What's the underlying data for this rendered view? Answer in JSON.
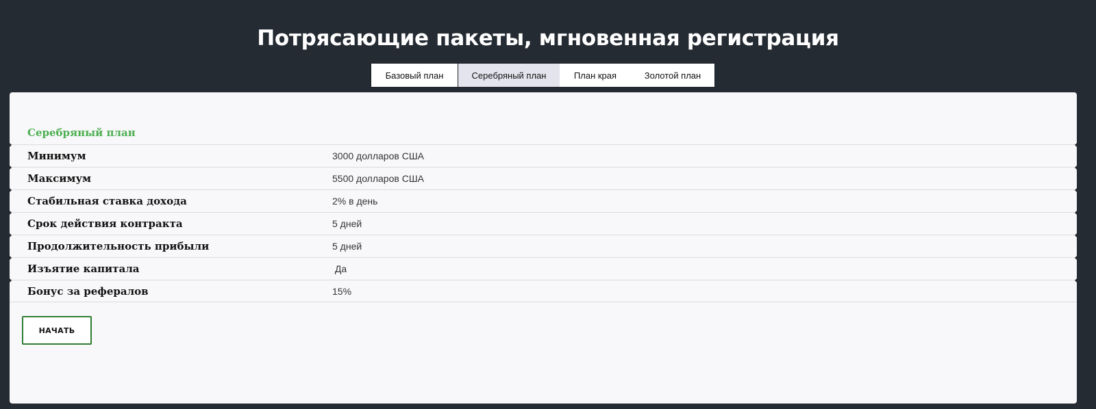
{
  "header": {
    "title": "Потрясающие пакеты, мгновенная регистрация"
  },
  "tabs": [
    {
      "label": "Базовый план",
      "active": false
    },
    {
      "label": "Серебряный план",
      "active": true
    },
    {
      "label": "План края",
      "active": false
    },
    {
      "label": "Золотой план",
      "active": false
    }
  ],
  "plan": {
    "name": "Серебряный план",
    "rows": [
      {
        "label": "Минимум",
        "value": "3000 долларов США"
      },
      {
        "label": "Максимум",
        "value": "5500 долларов США"
      },
      {
        "label": "Стабильная ставка дохода",
        "value": "2% в день"
      },
      {
        "label": "Срок действия контракта",
        "value": "5 дней"
      },
      {
        "label": "Продолжительность прибыли",
        "value": "5 дней"
      },
      {
        "label": "Изъятие капитала",
        "value": " Да"
      },
      {
        "label": "Бонус за рефералов",
        "value": "15%"
      }
    ],
    "start_label": "НАЧАТЬ"
  },
  "colors": {
    "background": "#252b33",
    "accent": "#4caf50",
    "button_border": "#2e7d32",
    "active_tab": "#e4e4ee"
  }
}
